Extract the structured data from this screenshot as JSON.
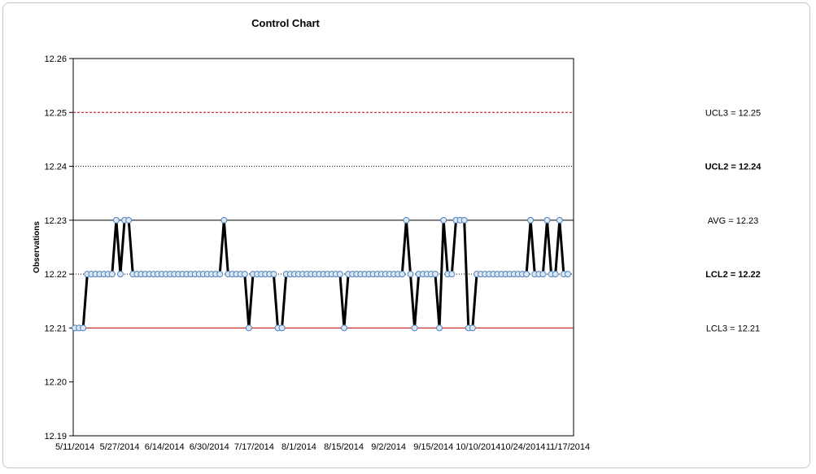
{
  "chart_data": {
    "type": "line",
    "title": "Control Chart",
    "ylabel": "Observations",
    "xlabel": "",
    "ylim": [
      12.19,
      12.26
    ],
    "y_ticks": [
      "12.19",
      "12.20",
      "12.21",
      "12.22",
      "12.23",
      "12.24",
      "12.25",
      "12.26"
    ],
    "x_tick_labels": [
      "5/11/2014",
      "5/27/2014",
      "6/14/2014",
      "6/30/2014",
      "7/17/2014",
      "8/1/2014",
      "8/15/2014",
      "9/2/2014",
      "9/15/2014",
      "10/10/2014",
      "10/24/2014",
      "11/17/2014"
    ],
    "series": [
      {
        "values": [
          12.21,
          12.21,
          12.21,
          12.22,
          12.22,
          12.22,
          12.22,
          12.22,
          12.22,
          12.22,
          12.23,
          12.22,
          12.23,
          12.23,
          12.22,
          12.22,
          12.22,
          12.22,
          12.22,
          12.22,
          12.22,
          12.22,
          12.22,
          12.22,
          12.22,
          12.22,
          12.22,
          12.22,
          12.22,
          12.22,
          12.22,
          12.22,
          12.22,
          12.22,
          12.22,
          12.22,
          12.23,
          12.22,
          12.22,
          12.22,
          12.22,
          12.22,
          12.21,
          12.22,
          12.22,
          12.22,
          12.22,
          12.22,
          12.22,
          12.21,
          12.21,
          12.22,
          12.22,
          12.22,
          12.22,
          12.22,
          12.22,
          12.22,
          12.22,
          12.22,
          12.22,
          12.22,
          12.22,
          12.22,
          12.22,
          12.21,
          12.22,
          12.22,
          12.22,
          12.22,
          12.22,
          12.22,
          12.22,
          12.22,
          12.22,
          12.22,
          12.22,
          12.22,
          12.22,
          12.22,
          12.23,
          12.22,
          12.21,
          12.22,
          12.22,
          12.22,
          12.22,
          12.22,
          12.21,
          12.23,
          12.22,
          12.22,
          12.23,
          12.23,
          12.23,
          12.21,
          12.21,
          12.22,
          12.22,
          12.22,
          12.22,
          12.22,
          12.22,
          12.22,
          12.22,
          12.22,
          12.22,
          12.22,
          12.22,
          12.22,
          12.23,
          12.22,
          12.22,
          12.22,
          12.23,
          12.22,
          12.22,
          12.23,
          12.22,
          12.22
        ]
      }
    ],
    "control_lines": [
      {
        "label": "UCL3 = 12.25",
        "value": 12.25,
        "style": "dashed",
        "color": "#c00000"
      },
      {
        "label": "UCL2 = 12.24",
        "value": 12.24,
        "style": "dotted",
        "color": "#000000"
      },
      {
        "label": "AVG =  12.23",
        "value": 12.23,
        "style": "solid",
        "color": "#000000"
      },
      {
        "label": "LCL2 = 12.22",
        "value": 12.22,
        "style": "dotted",
        "color": "#000000"
      },
      {
        "label": "LCL3 = 12.21",
        "value": 12.21,
        "style": "solid",
        "color": "#c00000"
      }
    ],
    "grid": false,
    "marker": "circle",
    "marker_fill": "#dce6f2",
    "marker_stroke": "#4f81bd",
    "line_color": "#000000"
  }
}
